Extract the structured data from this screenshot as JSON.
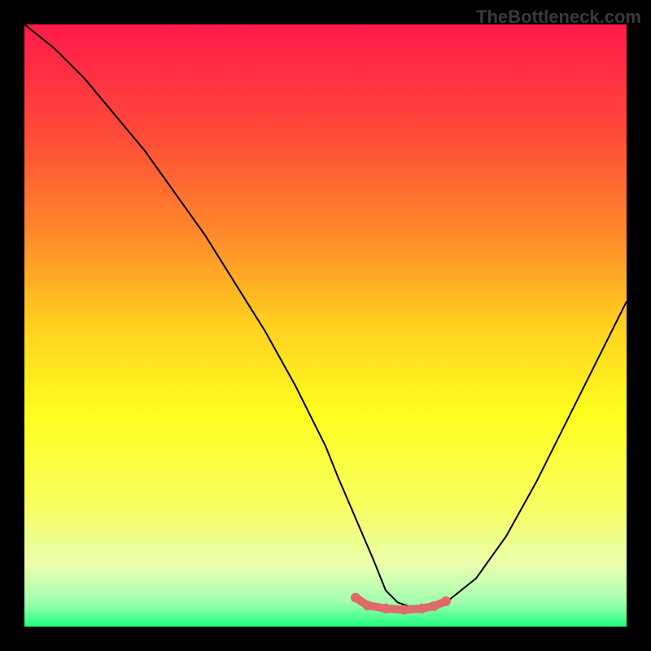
{
  "watermark": "TheBottleneck.com",
  "chart_data": {
    "type": "line",
    "title": "",
    "xlabel": "",
    "ylabel": "",
    "xlim": [
      0,
      100
    ],
    "ylim": [
      0,
      100
    ],
    "gradient_stops": [
      {
        "offset": 0,
        "color": "#ff1a4a"
      },
      {
        "offset": 18,
        "color": "#ff4a3a"
      },
      {
        "offset": 35,
        "color": "#ff8a2a"
      },
      {
        "offset": 50,
        "color": "#ffd020"
      },
      {
        "offset": 65,
        "color": "#ffff20"
      },
      {
        "offset": 80,
        "color": "#f8ff60"
      },
      {
        "offset": 90,
        "color": "#e8ffb0"
      },
      {
        "offset": 96,
        "color": "#a0ffb0"
      },
      {
        "offset": 100,
        "color": "#20ff80"
      }
    ],
    "series": [
      {
        "name": "bottleneck-curve",
        "type": "line",
        "color": "#000000",
        "x": [
          0,
          5,
          10,
          15,
          20,
          25,
          30,
          35,
          40,
          45,
          50,
          52,
          55,
          58,
          60,
          62,
          65,
          67,
          70,
          75,
          80,
          85,
          90,
          95,
          100
        ],
        "values": [
          100,
          96,
          91,
          85,
          79,
          72,
          65,
          57,
          49,
          40,
          30,
          25,
          18,
          11,
          6,
          4,
          3,
          3,
          4,
          8,
          15,
          24,
          34,
          44,
          54
        ]
      },
      {
        "name": "optimal-zone-dots",
        "type": "scatter",
        "color": "#e06a6a",
        "x": [
          55,
          57,
          60,
          63,
          66,
          68,
          70
        ],
        "values": [
          4.8,
          3.5,
          3.0,
          2.8,
          3.0,
          3.4,
          4.2
        ]
      }
    ]
  }
}
